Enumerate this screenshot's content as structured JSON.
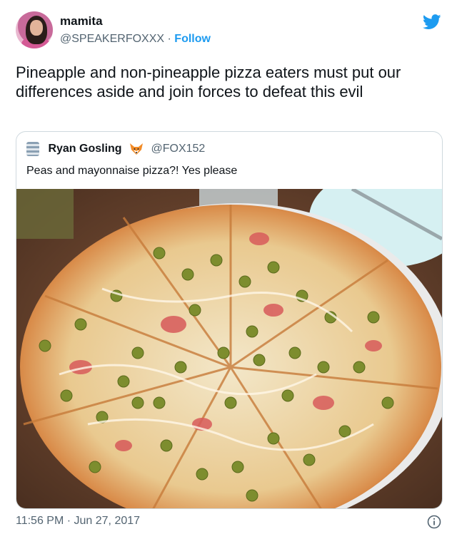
{
  "author": {
    "display_name": "mamita",
    "handle": "@SPEAKERFOXXX",
    "separator": "·",
    "follow_label": "Follow"
  },
  "tweet": {
    "text": "Pineapple and non-pineapple pizza eaters must put our differences aside and join forces to defeat this evil",
    "timestamp": "11:56 PM · Jun 27, 2017"
  },
  "quoted": {
    "display_name": "Ryan Gosling",
    "handle": "@FOX152",
    "text": "Peas and mayonnaise pizza?! Yes please"
  },
  "icons": {
    "platform": "twitter-bird-icon",
    "info": "info-icon",
    "badge": "fox-emoji-icon"
  },
  "colors": {
    "accent": "#1d9bf0",
    "secondary_text": "#536471",
    "border": "#cfd9de"
  }
}
